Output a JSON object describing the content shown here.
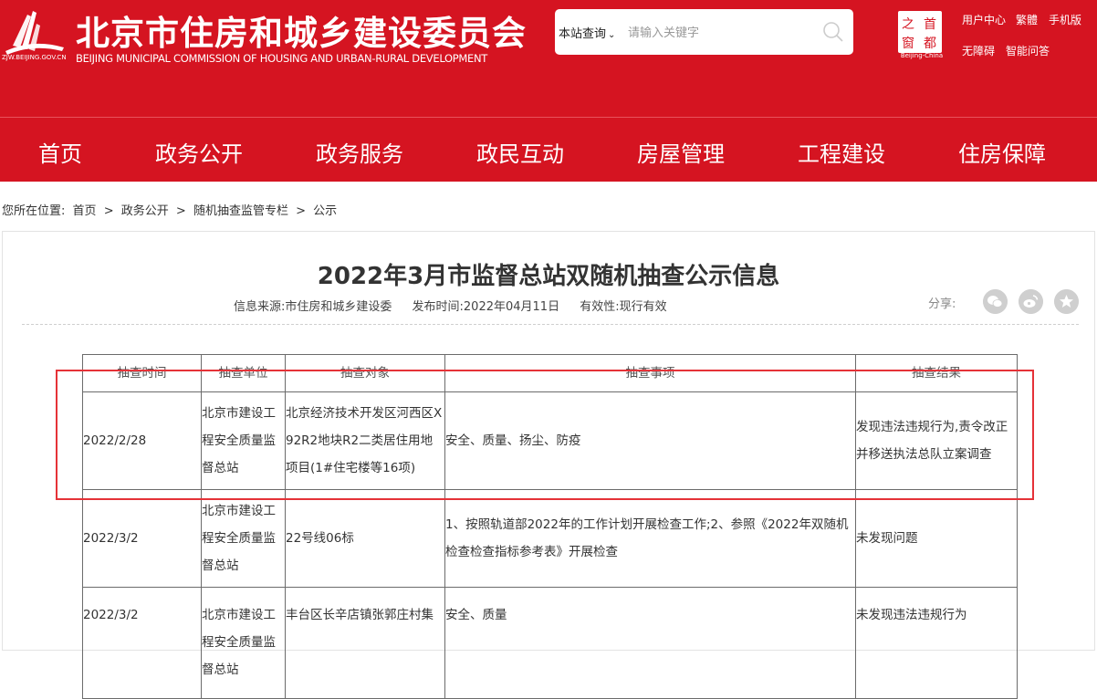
{
  "header": {
    "logo_url_text": "ZJW.BEIJING.GOV.CN",
    "title": "北京市住房和城乡建设委员会",
    "subtitle": "BEIJING MUNICIPAL COMMISSION OF HOUSING AND URBAN-RURAL DEVELOPMENT",
    "search": {
      "scope": "本站查询",
      "placeholder": "请输入关键字"
    },
    "capital_logo": {
      "chars": [
        "之",
        "首",
        "窗",
        "都"
      ],
      "text": "Beijing-China"
    },
    "links": {
      "user_center": "用户中心",
      "traditional": "繁體",
      "mobile": "手机版",
      "accessibility": "无障碍",
      "smart_qa": "智能问答"
    }
  },
  "nav": {
    "items": [
      "首页",
      "政务公开",
      "政务服务",
      "政民互动",
      "房屋管理",
      "工程建设",
      "住房保障"
    ]
  },
  "breadcrumb": {
    "label": "您所在位置:",
    "items": [
      "首页",
      "政务公开",
      "随机抽查监管专栏",
      "公示"
    ],
    "separator": ">"
  },
  "article": {
    "title": "2022年3月市监督总站双随机抽查公示信息",
    "source": "信息来源:市住房和城乡建设委",
    "published": "发布时间:2022年04月11日",
    "validity": "有效性:现行有效",
    "share_label": "分享:",
    "share_icons": [
      "wechat-icon",
      "weibo-icon",
      "favorite-icon"
    ]
  },
  "table": {
    "headers": [
      "抽查时间",
      "抽查单位",
      "抽查对象",
      "抽查事项",
      "抽查结果"
    ],
    "rows": [
      [
        "2022/2/28",
        "北京市建设工程安全质量监督总站",
        "北京经济技术开发区河西区X92R2地块R2二类居住用地项目(1#住宅楼等16项)",
        "安全、质量、扬尘、防疫",
        "发现违法违规行为,责令改正并移送执法总队立案调查"
      ],
      [
        "2022/3/2",
        "北京市建设工程安全质量监督总站",
        "22号线06标",
        "1、按照轨道部2022年的工作计划开展检查工作;2、参照《2022年双随机检查检查指标参考表》开展检查",
        "未发现问题"
      ],
      [
        "2022/3/2",
        "北京市建设工程安全质量监督总站",
        "丰台区长辛店镇张郭庄村集",
        "安全、质量",
        "未发现违法违规行为"
      ]
    ]
  },
  "colors": {
    "brand_red": "#d51421",
    "highlight_red": "#e53238"
  }
}
